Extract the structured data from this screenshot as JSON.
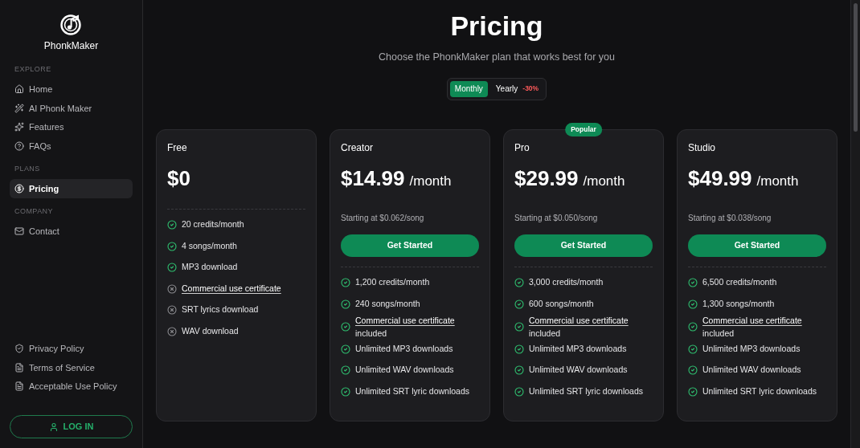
{
  "brand": {
    "name": "PhonkMaker"
  },
  "sidebar": {
    "sections": [
      {
        "heading": "EXPLORE",
        "items": [
          {
            "label": "Home",
            "selected": false
          },
          {
            "label": "AI Phonk Maker",
            "selected": false
          },
          {
            "label": "Features",
            "selected": false
          },
          {
            "label": "FAQs",
            "selected": false
          }
        ]
      },
      {
        "heading": "PLANS",
        "items": [
          {
            "label": "Pricing",
            "selected": true
          }
        ]
      },
      {
        "heading": "COMPANY",
        "items": [
          {
            "label": "Contact",
            "selected": false
          }
        ]
      }
    ],
    "footer_links": [
      "Privacy Policy",
      "Terms of Service",
      "Acceptable Use Policy"
    ],
    "login_button": "LOG IN"
  },
  "page": {
    "title": "Pricing",
    "subtitle": "Choose the PhonkMaker plan that works best for you"
  },
  "billing_toggle": [
    {
      "label": "Monthly",
      "selected": true
    },
    {
      "label": "Yearly",
      "selected": false,
      "badge": "-30%"
    }
  ],
  "plans": [
    {
      "name": "Free",
      "price": "$0",
      "features": [
        {
          "text": "20 credits/month",
          "included": true,
          "underlined": false
        },
        {
          "text": "4 songs/month",
          "included": true,
          "underlined": false
        },
        {
          "text": "MP3 download",
          "included": true,
          "underlined": false
        },
        {
          "text": "Commercial use certificate",
          "included": false,
          "underlined": true
        },
        {
          "text": "SRT lyrics download",
          "included": false,
          "underlined": false
        },
        {
          "text": "WAV download",
          "included": false,
          "underlined": false
        }
      ]
    },
    {
      "name": "Creator",
      "price": "$14.99",
      "period": "/month",
      "per_song": "Starting at $0.062/song",
      "button": "Get Started",
      "features": [
        {
          "text": "1,200 credits/month",
          "included": true,
          "underlined": false
        },
        {
          "text": "240 songs/month",
          "included": true,
          "underlined": false
        },
        {
          "text": "Commercial use certificate",
          "note": "included",
          "included": true,
          "underlined": true
        },
        {
          "text": "Unlimited MP3 downloads",
          "included": true,
          "underlined": false
        },
        {
          "text": "Unlimited WAV downloads",
          "included": true,
          "underlined": false
        },
        {
          "text": "Unlimited SRT lyric downloads",
          "included": true,
          "underlined": false
        }
      ]
    },
    {
      "name": "Pro",
      "badge": "Popular",
      "price": "$29.99",
      "period": "/month",
      "per_song": "Starting at $0.050/song",
      "button": "Get Started",
      "features": [
        {
          "text": "3,000 credits/month",
          "included": true,
          "underlined": false
        },
        {
          "text": "600 songs/month",
          "included": true,
          "underlined": false
        },
        {
          "text": "Commercial use certificate",
          "note": "included",
          "included": true,
          "underlined": true
        },
        {
          "text": "Unlimited MP3 downloads",
          "included": true,
          "underlined": false
        },
        {
          "text": "Unlimited WAV downloads",
          "included": true,
          "underlined": false
        },
        {
          "text": "Unlimited SRT lyric downloads",
          "included": true,
          "underlined": false
        }
      ]
    },
    {
      "name": "Studio",
      "price": "$49.99",
      "period": "/month",
      "per_song": "Starting at $0.038/song",
      "button": "Get Started",
      "features": [
        {
          "text": "6,500 credits/month",
          "included": true,
          "underlined": false
        },
        {
          "text": "1,300 songs/month",
          "included": true,
          "underlined": false
        },
        {
          "text": "Commercial use certificate",
          "note": "included",
          "included": true,
          "underlined": true
        },
        {
          "text": "Unlimited MP3 downloads",
          "included": true,
          "underlined": false
        },
        {
          "text": "Unlimited WAV downloads",
          "included": true,
          "underlined": false
        },
        {
          "text": "Unlimited SRT lyric downloads",
          "included": true,
          "underlined": false
        }
      ]
    }
  ]
}
